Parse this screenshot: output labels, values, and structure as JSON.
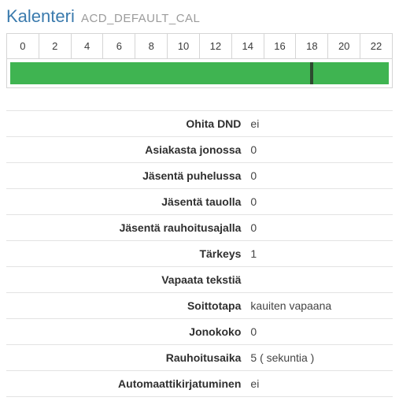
{
  "title": "Kalenteri",
  "subtitle": "ACD_DEFAULT_CAL",
  "chart_data": {
    "type": "bar",
    "categories": [
      "0",
      "2",
      "4",
      "6",
      "8",
      "10",
      "12",
      "14",
      "16",
      "18",
      "20",
      "22"
    ],
    "range_start": 0,
    "range_end": 24,
    "active_start": 0,
    "active_end": 24,
    "marker_hour": 19,
    "active_color": "#3fb451"
  },
  "properties": [
    {
      "label": "Ohita DND",
      "value": "ei"
    },
    {
      "label": "Asiakasta jonossa",
      "value": "0"
    },
    {
      "label": "Jäsentä puhelussa",
      "value": "0"
    },
    {
      "label": "Jäsentä tauolla",
      "value": "0"
    },
    {
      "label": "Jäsentä rauhoitusajalla",
      "value": "0"
    },
    {
      "label": "Tärkeys",
      "value": "1"
    },
    {
      "label": "Vapaata tekstiä",
      "value": ""
    },
    {
      "label": "Soittotapa",
      "value": "kauiten vapaana"
    },
    {
      "label": "Jonokoko",
      "value": "0"
    },
    {
      "label": "Rauhoitusaika",
      "value": "5 ( sekuntia )"
    },
    {
      "label": "Automaattikirjatuminen",
      "value": "ei"
    }
  ]
}
